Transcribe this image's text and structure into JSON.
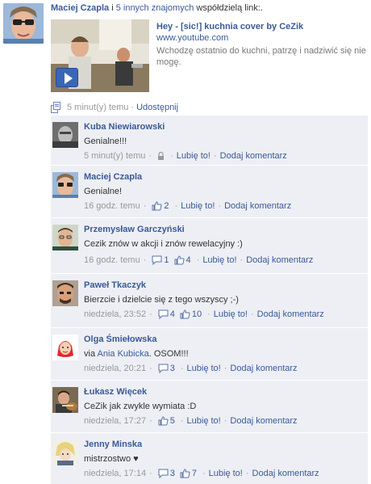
{
  "story": {
    "actor_name": "Maciej Czapla",
    "friends_text": "5 innych znajomych",
    "connector": " i ",
    "action_text": " współdzielą link:.",
    "attachment": {
      "title": "Hey - [sic!] kuchnia cover by CeZik",
      "url": "www.youtube.com",
      "description": "Wchodzę ostatnio do kuchni, patrzę i nadziwić się nie mogę."
    },
    "time": "5 minut(y) temu",
    "separator": "·",
    "share_label": "Udostępnij"
  },
  "comments": [
    {
      "author": "Kuba Niewiarowski",
      "text": "Genialne!!!",
      "time": "5 minut(y) temu",
      "replies": "",
      "likes": "",
      "like_label": "Lubię to!",
      "comment_label": "Dodaj komentarz",
      "has_lock": true
    },
    {
      "author": "Maciej Czapla",
      "text": "Genialne!",
      "time": "16 godz. temu",
      "replies": "",
      "likes": "2",
      "like_label": "Lubię to!",
      "comment_label": "Dodaj komentarz",
      "has_lock": false
    },
    {
      "author": "Przemysław Garczyński",
      "text": "Cezik znów w akcji i znów rewelacyjny :)",
      "time": "16 godz. temu",
      "replies": "1",
      "likes": "4",
      "like_label": "Lubię to!",
      "comment_label": "Dodaj komentarz",
      "has_lock": false
    },
    {
      "author": "Paweł Tkaczyk",
      "text": "Bierzcie i dzielcie się z tego wszyscy ;-)",
      "time": "niedziela, 23:52",
      "replies": "4",
      "likes": "10",
      "like_label": "Lubię to!",
      "comment_label": "Dodaj komentarz",
      "has_lock": false
    },
    {
      "author": "Olga Śmiełowska",
      "text_prefix": "via ",
      "mention": "Ania Kubicka",
      "text_suffix": ". OSOM!!!",
      "time": "niedziela, 20:21",
      "replies": "3",
      "likes": "",
      "like_label": "Lubię to!",
      "comment_label": "Dodaj komentarz",
      "has_lock": false
    },
    {
      "author": "Łukasz Więcek",
      "text": "CeZik jak zwykle wymiata :D",
      "time": "niedziela, 17:27",
      "replies": "",
      "likes": "5",
      "like_label": "Lubię to!",
      "comment_label": "Dodaj komentarz",
      "has_lock": false
    },
    {
      "author": "Jenny Minska",
      "text": "mistrzostwo ♥",
      "time": "niedziela, 17:14",
      "replies": "3",
      "likes": "7",
      "like_label": "Lubię to!",
      "comment_label": "Dodaj komentarz",
      "has_lock": false
    }
  ]
}
